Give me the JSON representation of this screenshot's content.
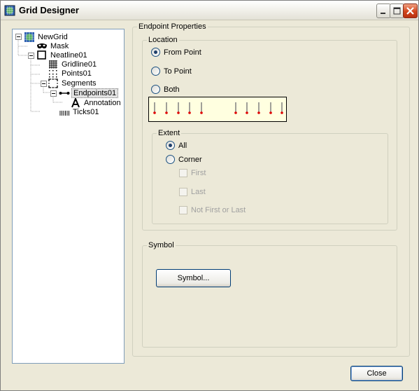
{
  "window": {
    "title": "Grid Designer"
  },
  "tree": {
    "nodes": [
      {
        "label": "NewGrid",
        "icon": "grid-globe-icon"
      },
      {
        "label": "Mask",
        "icon": "mask-icon"
      },
      {
        "label": "Neatline01",
        "icon": "neatline-icon"
      },
      {
        "label": "Gridline01",
        "icon": "gridline-icon"
      },
      {
        "label": "Points01",
        "icon": "points-icon"
      },
      {
        "label": "Segments",
        "icon": "segments-icon"
      },
      {
        "label": "Endpoints01",
        "icon": "endpoints-icon"
      },
      {
        "label": "Annotation",
        "icon": "annotation-icon"
      },
      {
        "label": "Ticks01",
        "icon": "ticks-icon"
      }
    ],
    "selected": "Endpoints01"
  },
  "properties": {
    "title": "Endpoint Properties",
    "location": {
      "title": "Location",
      "options": [
        "From Point",
        "To Point",
        "Both"
      ],
      "selected": "From Point"
    },
    "extent": {
      "title": "Extent",
      "options": [
        "All",
        "Corner"
      ],
      "selected": "All",
      "corner_options": [
        "First",
        "Last",
        "Not First or Last"
      ]
    },
    "symbol": {
      "title": "Symbol",
      "button_label": "Symbol..."
    }
  },
  "footer": {
    "close_label": "Close"
  },
  "colors": {
    "endpoint_marker": "#e00000",
    "preview_background": "#ffffe0"
  }
}
